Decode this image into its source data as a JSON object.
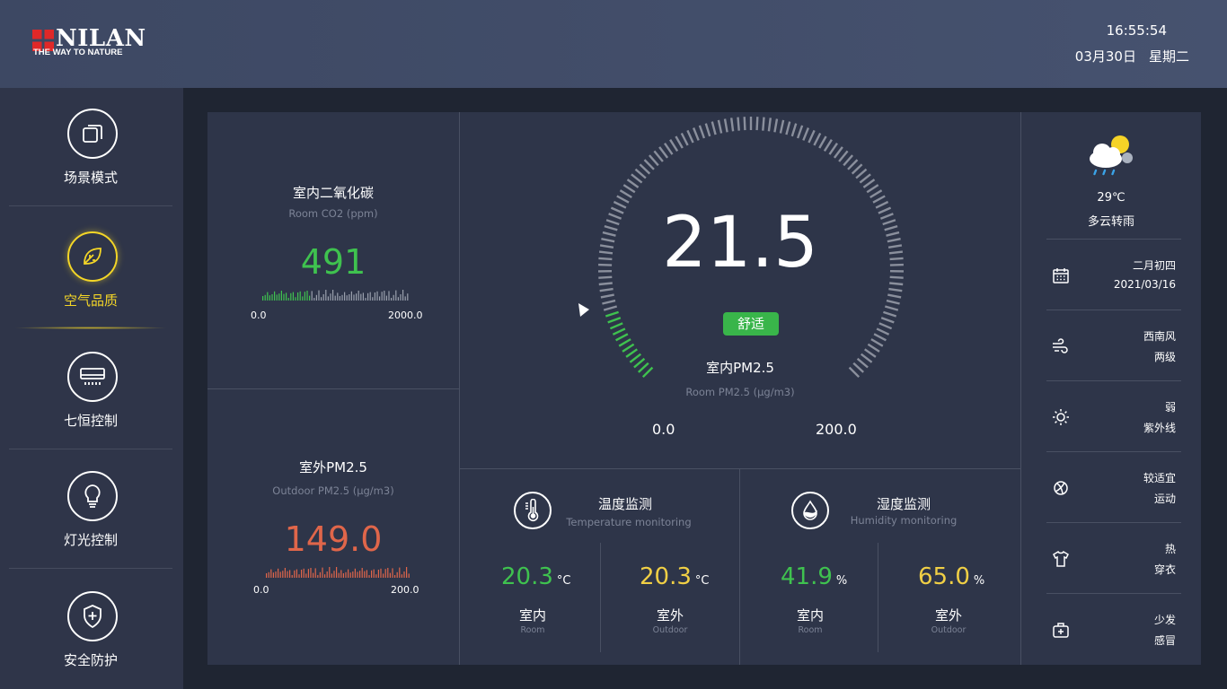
{
  "header": {
    "logo_text": "NILAN",
    "logo_slogan": "THE WAY TO NATURE",
    "time": "16:55:54",
    "date": "03月30日",
    "weekday": "星期二"
  },
  "sidebar": {
    "items": [
      {
        "label": "场景模式",
        "icon": "scene-icon"
      },
      {
        "label": "空气品质",
        "icon": "leaf-icon",
        "active": true
      },
      {
        "label": "七恒控制",
        "icon": "air-conditioner-icon"
      },
      {
        "label": "灯光控制",
        "icon": "lightbulb-icon"
      },
      {
        "label": "安全防护",
        "icon": "shield-icon"
      }
    ],
    "active_color": "#f4d627"
  },
  "co2": {
    "title": "室内二氧化碳",
    "subtitle": "Room  CO2 (ppm)",
    "value": "491",
    "min": "0.0",
    "max": "2000.0",
    "color": "#3fc24f"
  },
  "outdoor_pm": {
    "title": "室外PM2.5",
    "subtitle": "Outdoor  PM2.5 (μg/m3)",
    "value": "149.0",
    "min": "0.0",
    "max": "200.0",
    "color": "#e0664a"
  },
  "gauge": {
    "value": "21.5",
    "level_fraction": 0.1075,
    "status": "舒适",
    "title": "室内PM2.5",
    "subtitle": "Room  PM2.5 (μg/m3)",
    "min": "0.0",
    "max": "200.0",
    "active_color": "#3fc24f",
    "inactive_color": "#8a8f9c"
  },
  "temperature": {
    "title": "温度监测",
    "subtitle": "Temperature monitoring",
    "indoor_value": "20.3",
    "outdoor_value": "20.3",
    "unit": "°C",
    "indoor_label": "室内",
    "indoor_label_en": "Room",
    "outdoor_label": "室外",
    "outdoor_label_en": "Outdoor",
    "indoor_color": "#3fc24f",
    "outdoor_color": "#f0cf45"
  },
  "humidity": {
    "title": "湿度监测",
    "subtitle": "Humidity monitoring",
    "indoor_value": "41.9",
    "outdoor_value": "65.0",
    "unit": "%",
    "indoor_label": "室内",
    "indoor_label_en": "Room",
    "outdoor_label": "室外",
    "outdoor_label_en": "Outdoor",
    "indoor_color": "#3fc24f",
    "outdoor_color": "#f0cf45"
  },
  "weather": {
    "icon": "partly-cloudy-rain-icon",
    "temp": "29℃",
    "desc": "多云转雨",
    "rows": [
      {
        "icon": "calendar-icon",
        "line1": "二月初四",
        "line2": "2021/03/16"
      },
      {
        "icon": "wind-icon",
        "line1": "西南风",
        "line2": "两级"
      },
      {
        "icon": "sun-icon",
        "line1": "弱",
        "line2": "紫外线"
      },
      {
        "icon": "sport-ball-icon",
        "line1": "较适宜",
        "line2": "运动"
      },
      {
        "icon": "shirt-icon",
        "line1": "热",
        "line2": "穿衣"
      },
      {
        "icon": "medicine-kit-icon",
        "line1": "少发",
        "line2": "感冒"
      }
    ]
  }
}
